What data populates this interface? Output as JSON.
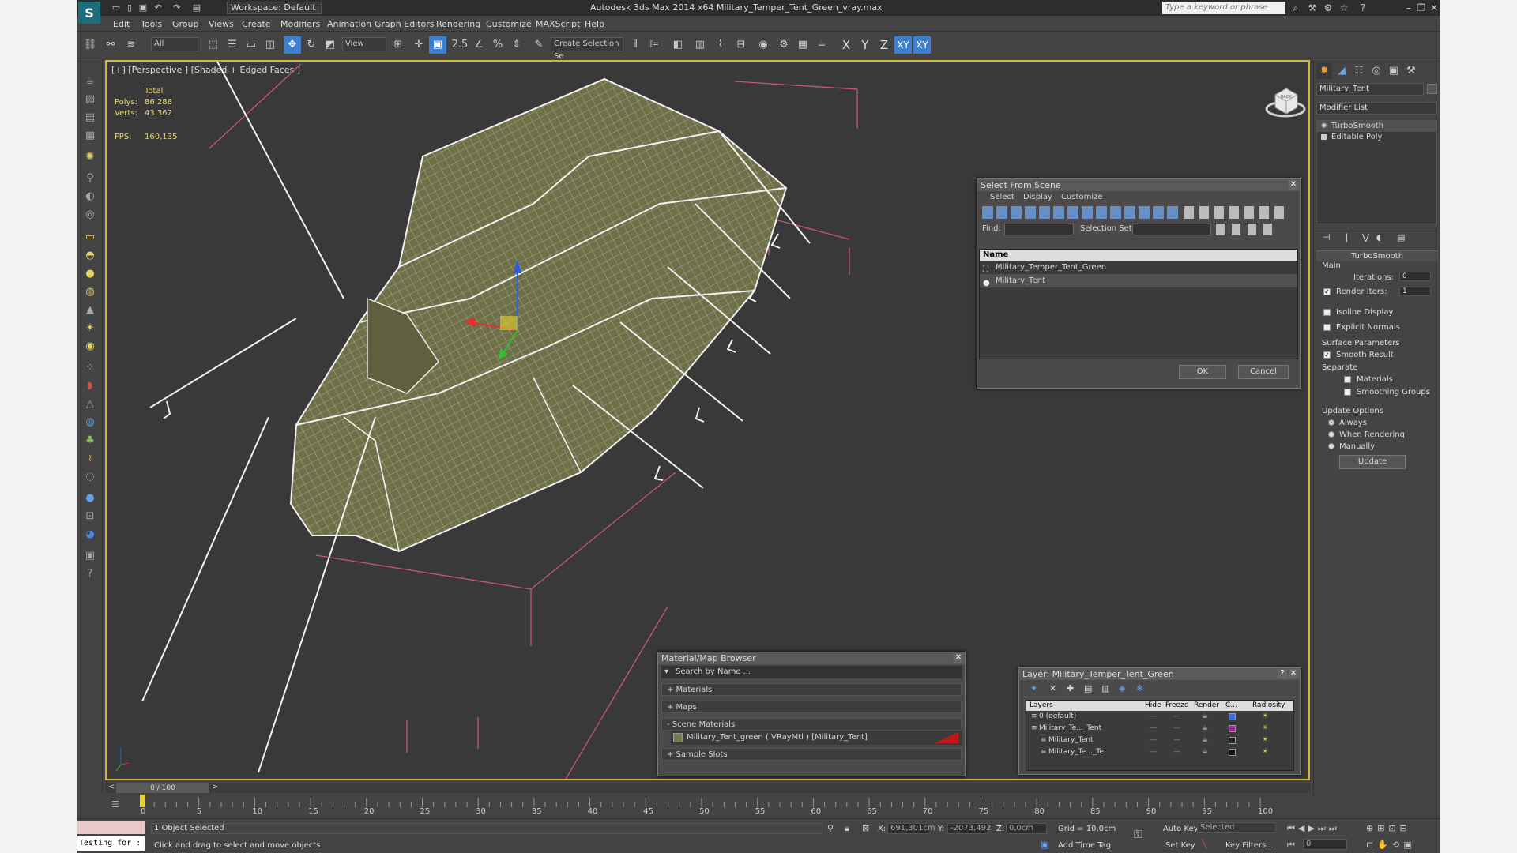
{
  "titlebar": {
    "workspace": "Workspace: Default",
    "title": "Autodesk 3ds Max  2014 x64      Military_Temper_Tent_Green_vray.max",
    "search_placeholder": "Type a keyword or phrase"
  },
  "menu": [
    "Edit",
    "Tools",
    "Group",
    "Views",
    "Create",
    "Modifiers",
    "Animation",
    "Graph Editors",
    "Rendering",
    "Customize",
    "MAXScript",
    "Help"
  ],
  "toolbar": {
    "selection_filter": "All",
    "ref_coord": "View",
    "selection_set": "Create Selection Se",
    "snap_label": "2.5",
    "axes": [
      "X",
      "Y",
      "Z",
      "XY",
      "XY"
    ]
  },
  "viewport": {
    "label": "[+] [Perspective ] [Shaded + Edged Faces ]",
    "stats": {
      "total_label": "Total",
      "polys_label": "Polys:",
      "polys": "86 288",
      "verts_label": "Verts:",
      "verts": "43 362",
      "fps_label": "FPS:",
      "fps": "160,135"
    },
    "viewcube_label": "BACK"
  },
  "select_dialog": {
    "title": "Select From Scene",
    "tabs": [
      "Select",
      "Display",
      "Customize"
    ],
    "find_label": "Find:",
    "selection_set_label": "Selection Set:",
    "column": "Name",
    "items": [
      "Military_Temper_Tent_Green",
      "Military_Tent"
    ],
    "ok": "OK",
    "cancel": "Cancel"
  },
  "command_panel": {
    "object_name": "Military_Tent",
    "modifier_list": "Modifier List",
    "stack": [
      "TurboSmooth",
      "Editable Poly"
    ],
    "rollout": "TurboSmooth",
    "main": "Main",
    "iterations_label": "Iterations:",
    "iterations": "0",
    "render_iters_label": "Render Iters:",
    "render_iters": "1",
    "isoline": "Isoline Display",
    "explicit_normals": "Explicit Normals",
    "surface_params": "Surface Parameters",
    "smooth_result": "Smooth Result",
    "separate": "Separate",
    "materials": "Materials",
    "smoothing_groups": "Smoothing Groups",
    "update_options": "Update Options",
    "always": "Always",
    "when_rendering": "When Rendering",
    "manually": "Manually",
    "update": "Update"
  },
  "material_browser": {
    "title": "Material/Map Browser",
    "search": "Search by Name ...",
    "sections": [
      "+ Materials",
      "+ Maps",
      "- Scene Materials"
    ],
    "material": "Military_Tent_green  ( VRayMtl )  [Military_Tent]",
    "sample_slots": "+ Sample Slots"
  },
  "layer_dialog": {
    "title": "Layer: Military_Temper_Tent_Green",
    "columns": [
      "Layers",
      "Hide",
      "Freeze",
      "Render",
      "C...",
      "Radiosity"
    ],
    "rows": [
      {
        "name": "0 (default)",
        "color": "#3c6be0"
      },
      {
        "name": "Military_Te..._Tent",
        "color": "#a020a0"
      },
      {
        "name": "Military_Tent",
        "color": "#222222"
      },
      {
        "name": "Military_Te..._Te",
        "color": "#111111"
      }
    ]
  },
  "timeline": {
    "frame": "0 / 100",
    "ticks": [
      "0",
      "5",
      "10",
      "15",
      "20",
      "25",
      "30",
      "35",
      "40",
      "45",
      "50",
      "55",
      "60",
      "65",
      "70",
      "75",
      "80",
      "85",
      "90",
      "95",
      "100"
    ]
  },
  "statusbar": {
    "script_prompt": "Testing for :",
    "selected": "1 Object Selected",
    "hint": "Click and drag to select and move objects",
    "x_label": "X:",
    "x": "691,301cm",
    "y_label": "Y:",
    "y": "-2073,492",
    "z_label": "Z:",
    "z": "0,0cm",
    "grid": "Grid = 10,0cm",
    "add_time_tag": "Add Time Tag",
    "auto_key": "Auto Key",
    "set_key": "Set Key",
    "key_mode": "Selected",
    "key_filters": "Key Filters...",
    "frame_field": "0"
  }
}
